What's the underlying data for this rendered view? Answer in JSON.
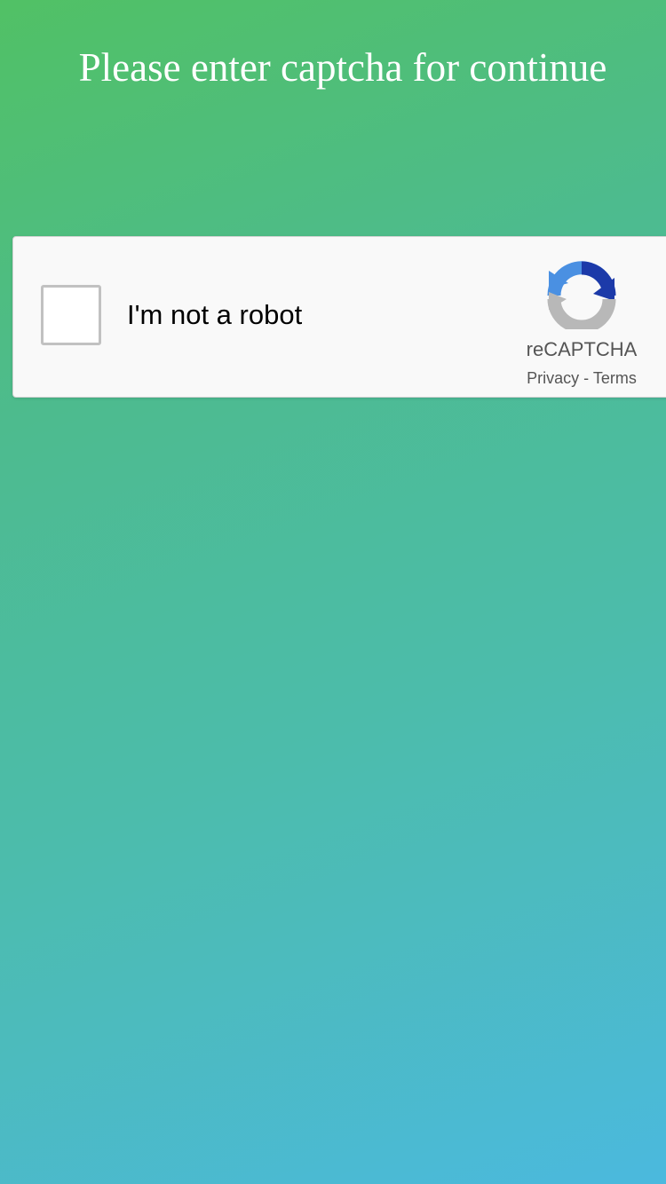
{
  "page": {
    "title": "Please enter captcha for continue"
  },
  "recaptcha": {
    "checkbox_label": "I'm not a robot",
    "checked": false,
    "brand": "reCAPTCHA",
    "privacy_label": "Privacy",
    "separator": " - ",
    "terms_label": "Terms",
    "logo_icon": "recaptcha-logo-icon",
    "colors": {
      "logo_blue_dark": "#1c3aa9",
      "logo_blue_light": "#4a90e2",
      "logo_gray": "#b8b8b8",
      "widget_background": "#f9f9f9",
      "checkbox_border": "#c1c1c1"
    }
  },
  "background": {
    "gradient_start": "#51c165",
    "gradient_end": "#4bb9de"
  }
}
